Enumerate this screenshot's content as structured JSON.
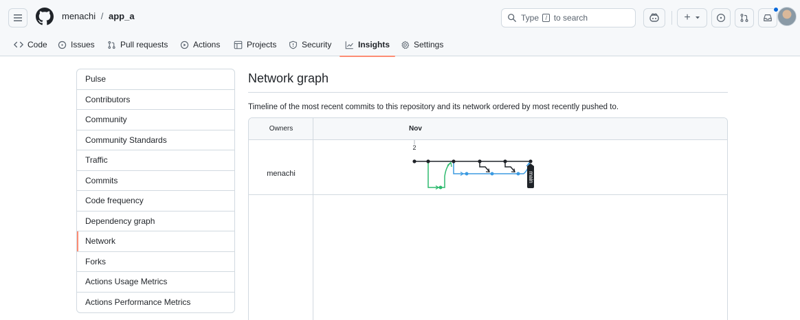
{
  "header": {
    "owner": "menachi",
    "separator": "/",
    "repo": "app_a",
    "search": {
      "prefix": "Type",
      "key": "/",
      "suffix": "to search"
    },
    "plus_label": "+"
  },
  "tabs": [
    {
      "label": "Code",
      "icon": "code-icon"
    },
    {
      "label": "Issues",
      "icon": "issue-opened-icon"
    },
    {
      "label": "Pull requests",
      "icon": "git-pull-request-icon"
    },
    {
      "label": "Actions",
      "icon": "play-icon"
    },
    {
      "label": "Projects",
      "icon": "table-icon"
    },
    {
      "label": "Security",
      "icon": "shield-icon"
    },
    {
      "label": "Insights",
      "icon": "graph-icon",
      "selected": true
    },
    {
      "label": "Settings",
      "icon": "gear-icon"
    }
  ],
  "sidebar": {
    "items": [
      {
        "label": "Pulse"
      },
      {
        "label": "Contributors"
      },
      {
        "label": "Community"
      },
      {
        "label": "Community Standards"
      },
      {
        "label": "Traffic"
      },
      {
        "label": "Commits"
      },
      {
        "label": "Code frequency"
      },
      {
        "label": "Dependency graph"
      },
      {
        "label": "Network",
        "active": true
      },
      {
        "label": "Forks"
      },
      {
        "label": "Actions Usage Metrics"
      },
      {
        "label": "Actions Performance Metrics"
      }
    ]
  },
  "main": {
    "title": "Network graph",
    "description": "Timeline of the most recent commits to this repository and its network ordered by most recently pushed to.",
    "graph": {
      "owners_header": "Owners",
      "month": "Nov",
      "day": "2",
      "owner": "menachi",
      "branch_label": "main"
    }
  },
  "colors": {
    "accent_underline": "#fd8c73",
    "branch_main": "#1f2328",
    "branch_blue": "#3b9ae1",
    "branch_green": "#2dba6e"
  }
}
